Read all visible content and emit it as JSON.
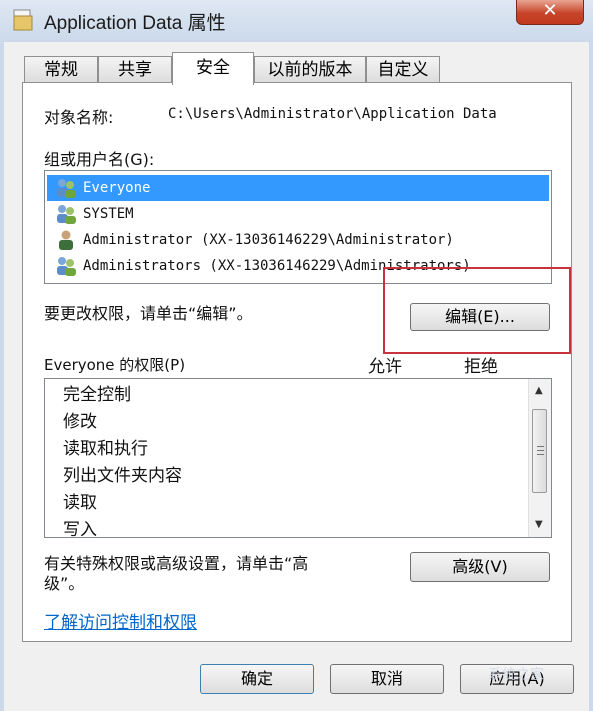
{
  "window": {
    "title": "Application Data 属性",
    "close_label": "✕"
  },
  "tabs": [
    {
      "label": "常规"
    },
    {
      "label": "共享"
    },
    {
      "label": "安全",
      "active": true
    },
    {
      "label": "以前的版本"
    },
    {
      "label": "自定义"
    }
  ],
  "object": {
    "label": "对象名称:",
    "value": "C:\\Users\\Administrator\\Application Data"
  },
  "groups": {
    "label": "组或用户名(G):",
    "items": [
      {
        "name": "Everyone",
        "icon": "user-group-icon",
        "selected": true
      },
      {
        "name": "SYSTEM",
        "icon": "user-group-icon"
      },
      {
        "name": "Administrator  (XX-13036146229\\Administrator)",
        "icon": "user-icon"
      },
      {
        "name": "Administrators (XX-13036146229\\Administrators)",
        "icon": "user-group-icon"
      }
    ]
  },
  "change_hint": "要更改权限，请单击“编辑”。",
  "edit_button": "编辑(E)...",
  "permissions": {
    "header": "Everyone 的权限(P)",
    "allow_header": "允许",
    "deny_header": "拒绝",
    "items": [
      "完全控制",
      "修改",
      "读取和执行",
      "列出文件夹内容",
      "读取",
      "写入"
    ]
  },
  "advanced": {
    "hint_line1": "有关特殊权限或高级设置，请单击“高",
    "hint_line2": "级”。",
    "button": "高级(V)"
  },
  "learn_link": "了解访问控制和权限",
  "footer": {
    "ok": "确定",
    "cancel": "取消",
    "apply": "应用(A)"
  },
  "watermark": "系统之家",
  "colors": {
    "selection": "#3399ff",
    "highlight_box": "#c8323c",
    "link": "#0066cc"
  }
}
